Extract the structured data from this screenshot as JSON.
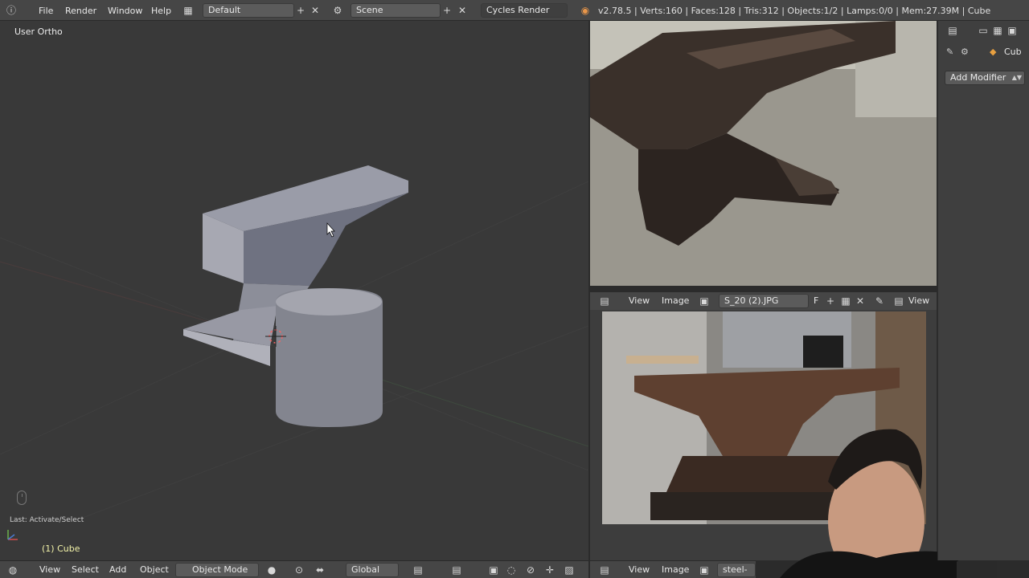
{
  "topbar": {
    "menus": [
      "File",
      "Render",
      "Window",
      "Help"
    ],
    "layout": "Default",
    "scene": "Scene",
    "engine": "Cycles Render",
    "stats": "v2.78.5 | Verts:160 | Faces:128 | Tris:312 | Objects:1/2 | Lamps:0/0 | Mem:27.39M | Cube"
  },
  "viewport": {
    "title": "User Ortho",
    "last_op": "Last: Activate/Select",
    "object_name": "(1) Cube"
  },
  "bottom_left": {
    "menus": [
      "View",
      "Select",
      "Add",
      "Object"
    ],
    "mode": "Object Mode",
    "orientation": "Global"
  },
  "image_editor": {
    "menus": [
      "View",
      "Image"
    ],
    "image_name": "S_20 (2).JPG",
    "fake_user": "F",
    "view": "View"
  },
  "bottom_right": {
    "menus": [
      "View",
      "Image"
    ],
    "image_name": "steel-anv"
  },
  "properties": {
    "crumb": "Cub",
    "add_modifier": "Add Modifier"
  },
  "colors": {
    "header": "#464646",
    "viewport_bg": "#393939",
    "object_name": "#f2f2a8",
    "mesh": "#7d8190"
  }
}
